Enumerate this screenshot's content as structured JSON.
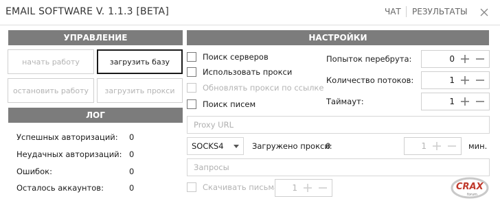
{
  "window": {
    "title": "EMAIL SOFTWARE V. 1.1.3 [BETA]",
    "nav": {
      "chat": "ЧАТ",
      "results": "РЕЗУЛЬТАТЫ"
    },
    "close_icon": "close-icon"
  },
  "control": {
    "header": "УПРАВЛЕНИЕ",
    "buttons": {
      "start": "начать работу",
      "load_base": "загрузить базу",
      "stop": "остановить работу",
      "load_proxy": "загрузить прокси"
    }
  },
  "log": {
    "header": "ЛОГ",
    "rows": [
      {
        "label": "Успешных авторизаций:",
        "value": "0"
      },
      {
        "label": "Неудачных авторизаций:",
        "value": "0"
      },
      {
        "label": "Ошибок:",
        "value": "0"
      },
      {
        "label": "Осталось аккаунтов:",
        "value": "0"
      }
    ]
  },
  "settings": {
    "header": "НАСТРОЙКИ",
    "checkboxes": {
      "server_search": "Поиск серверов",
      "use_proxy": "Использовать прокси",
      "update_proxy_link": "Обновлять прокси по ссылке",
      "mail_search": "Поиск писем"
    },
    "retries": {
      "label": "Попыток перебрута:",
      "value": "0"
    },
    "threads": {
      "label": "Количество потоков:",
      "value": "1"
    },
    "timeout": {
      "label": "Таймаут:",
      "value": "1"
    },
    "proxy_url_placeholder": "Proxy URL",
    "proxy_type": "SOCKS4",
    "proxies_loaded_label": "Загружено прокси:",
    "proxies_loaded_value": "0",
    "minutes": {
      "value": "1",
      "unit": "мин."
    },
    "queries_placeholder": "Запросы",
    "download_letters": {
      "label": "Скачивать письма",
      "value": "1"
    }
  },
  "watermark": {
    "brand": "CRAX",
    "sub": "forum"
  },
  "colors": {
    "header_bg": "#7c7c7c",
    "watermark_red": "#c0392b"
  }
}
